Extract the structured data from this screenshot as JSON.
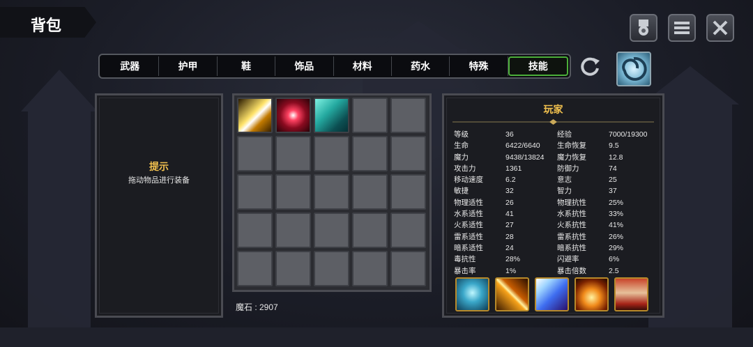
{
  "header": {
    "title": "背包"
  },
  "tabs": [
    {
      "label": "武器"
    },
    {
      "label": "护甲"
    },
    {
      "label": "鞋"
    },
    {
      "label": "饰品"
    },
    {
      "label": "材料"
    },
    {
      "label": "药水"
    },
    {
      "label": "特殊"
    },
    {
      "label": "技能",
      "active": true
    }
  ],
  "hint": {
    "title": "提示",
    "text": "拖动物品进行装备"
  },
  "inventory": {
    "rows": 5,
    "cols": 5,
    "items": [
      "light-arrow-skill",
      "crimson-slash-skill",
      "water-splash-skill"
    ]
  },
  "mana_stone": {
    "text": "魔石 : 2907"
  },
  "player": {
    "title": "玩家",
    "stats": [
      [
        "等级",
        "36",
        "经验",
        "7000/19300"
      ],
      [
        "生命",
        "6422/6640",
        "生命恢复",
        "9.5"
      ],
      [
        "魔力",
        "9438/13824",
        "魔力恢复",
        "12.8"
      ],
      [
        "攻击力",
        "1361",
        "防御力",
        "74"
      ],
      [
        "移动速度",
        "6.2",
        "意志",
        "25"
      ],
      [
        "敏捷",
        "32",
        "智力",
        "37"
      ],
      [
        "物理适性",
        "26",
        "物理抗性",
        "25%"
      ],
      [
        "水系适性",
        "41",
        "水系抗性",
        "33%"
      ],
      [
        "火系适性",
        "27",
        "火系抗性",
        "41%"
      ],
      [
        "雷系适性",
        "28",
        "雷系抗性",
        "26%"
      ],
      [
        "暗系适性",
        "24",
        "暗系抗性",
        "29%"
      ],
      [
        "毒抗性",
        "28%",
        "闪避率",
        "6%"
      ],
      [
        "暴击率",
        "1%",
        "暴击倍数",
        "2.5"
      ]
    ],
    "skills": [
      "spirit-skill",
      "cross-swords-skill",
      "lightning-beam-skill",
      "fire-palm-skill",
      "hero-portrait"
    ]
  },
  "colors": {
    "accent_gold": "#f2c14e",
    "active_tab": "#4caf3a"
  }
}
